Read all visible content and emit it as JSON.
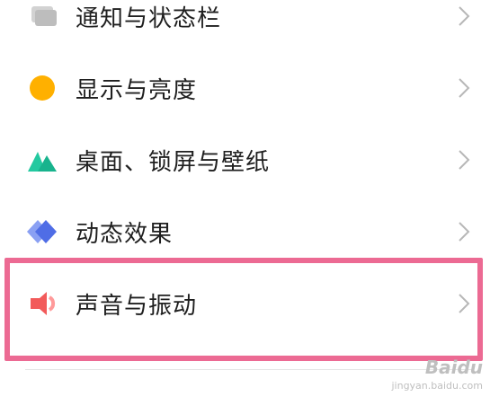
{
  "settings_list": {
    "items": [
      {
        "label": "通知与状态栏",
        "icon": "notification-icon"
      },
      {
        "label": "显示与亮度",
        "icon": "brightness-icon"
      },
      {
        "label": "桌面、锁屏与壁纸",
        "icon": "wallpaper-icon"
      },
      {
        "label": "动态效果",
        "icon": "animation-icon"
      },
      {
        "label": "声音与振动",
        "icon": "speaker-icon"
      }
    ]
  },
  "highlight": {
    "color": "#ec6a93",
    "target": "声音与振动"
  },
  "watermark": {
    "logo_text": "Baidu",
    "url": "jingyan.baidu.com"
  }
}
